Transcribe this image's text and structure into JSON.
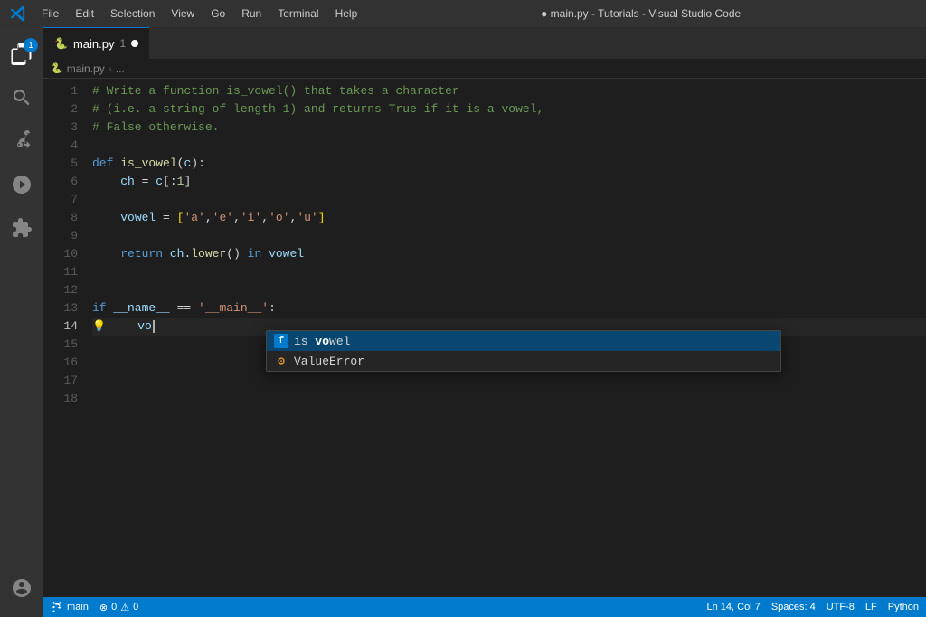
{
  "titlebar": {
    "menu_items": [
      "File",
      "Edit",
      "Selection",
      "View",
      "Go",
      "Run",
      "Terminal",
      "Help"
    ],
    "title": "● main.py - Tutorials - Visual Studio Code"
  },
  "tab": {
    "filename": "main.py",
    "number": "1",
    "modified": true
  },
  "breadcrumb": {
    "filename": "main.py",
    "ellipsis": "..."
  },
  "code": {
    "lines": [
      {
        "num": "1",
        "content": "comment1",
        "text": "# Write a function is_vowel() that takes a character"
      },
      {
        "num": "2",
        "content": "comment2",
        "text": "# (i.e. a string of length 1) and returns True if it is a vowel,"
      },
      {
        "num": "3",
        "content": "comment3",
        "text": "# False otherwise."
      },
      {
        "num": "4",
        "content": "empty",
        "text": ""
      },
      {
        "num": "5",
        "content": "def1",
        "text": "def is_vowel(c):"
      },
      {
        "num": "6",
        "content": "assign1",
        "text": "    ch = c[:1]"
      },
      {
        "num": "7",
        "content": "empty",
        "text": ""
      },
      {
        "num": "8",
        "content": "assign2",
        "text": "    vowel = ['a','e','i','o','u']"
      },
      {
        "num": "9",
        "content": "empty",
        "text": ""
      },
      {
        "num": "10",
        "content": "return1",
        "text": "    return ch.lower() in vowel"
      },
      {
        "num": "11",
        "content": "empty",
        "text": ""
      },
      {
        "num": "12",
        "content": "empty",
        "text": ""
      },
      {
        "num": "13",
        "content": "if1",
        "text": "if __name__ == '__main__':"
      },
      {
        "num": "14",
        "content": "typing",
        "text": "    vo"
      },
      {
        "num": "15",
        "content": "empty",
        "text": ""
      },
      {
        "num": "16",
        "content": "empty",
        "text": ""
      },
      {
        "num": "17",
        "content": "empty",
        "text": ""
      },
      {
        "num": "18",
        "content": "empty",
        "text": ""
      }
    ]
  },
  "autocomplete": {
    "items": [
      {
        "label": "is_vowel",
        "type": "function",
        "icon": "func",
        "prefix": "vo"
      },
      {
        "label": "ValueError",
        "type": "class",
        "icon": "class",
        "prefix": "V"
      }
    ],
    "selected": 0
  },
  "statusbar": {
    "branch": "main",
    "errors": "0",
    "warnings": "0",
    "line": "Ln 14, Col 7",
    "spaces": "Spaces: 4",
    "encoding": "UTF-8",
    "eol": "LF",
    "language": "Python"
  },
  "activity_icons": {
    "explorer": "explorer-icon",
    "search": "search-icon",
    "source_control": "source-control-icon",
    "run": "run-icon",
    "extensions": "extensions-icon",
    "accounts": "accounts-icon",
    "settings": "settings-icon"
  },
  "badge": {
    "count": "1"
  }
}
